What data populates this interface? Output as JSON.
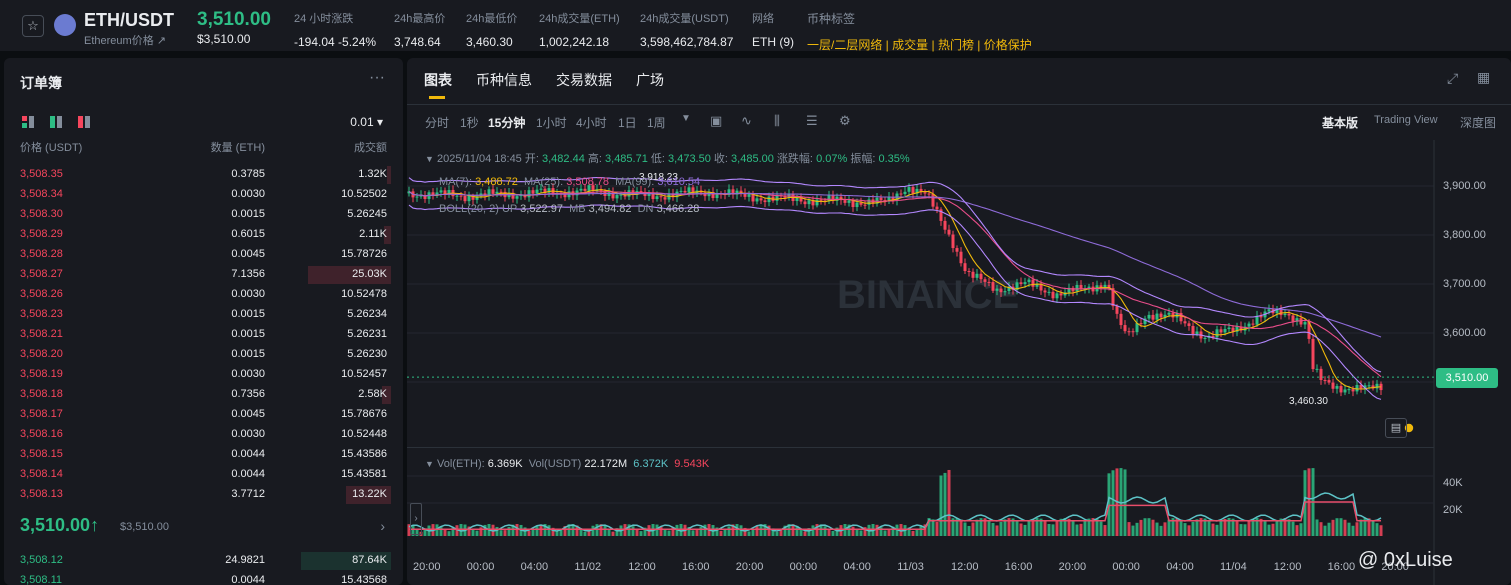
{
  "header": {
    "pair": "ETH/USDT",
    "subtitle": "Ethereum价格 ↗",
    "last_price": "3,510.00",
    "last_price_usd": "$3,510.00",
    "stats": [
      {
        "label": "24 小时涨跌",
        "value": "-194.04 -5.24%",
        "tone": "dn"
      },
      {
        "label": "24h最高价",
        "value": "3,748.64"
      },
      {
        "label": "24h最低价",
        "value": "3,460.30"
      },
      {
        "label": "24h成交量(ETH)",
        "value": "1,002,242.18"
      },
      {
        "label": "24h成交量(USDT)",
        "value": "3,598,462,784.87"
      },
      {
        "label": "网络",
        "value": "ETH (9)"
      }
    ],
    "tags_label": "币种标签",
    "tags": [
      "一层/二层网络",
      "成交量",
      "热门榜",
      "价格保护"
    ]
  },
  "orderbook": {
    "title": "订单簿",
    "precision": "0.01 ▾",
    "col_price": "价格 (USDT)",
    "col_amount": "数量 (ETH)",
    "col_total": "成交额",
    "asks": [
      {
        "price": "3,508.35",
        "amount": "0.3785",
        "total": "1.32K",
        "depth": 0.05
      },
      {
        "price": "3,508.34",
        "amount": "0.0030",
        "total": "10.52502",
        "depth": 0
      },
      {
        "price": "3,508.30",
        "amount": "0.0015",
        "total": "5.26245",
        "depth": 0
      },
      {
        "price": "3,508.29",
        "amount": "0.6015",
        "total": "2.11K",
        "depth": 0.08
      },
      {
        "price": "3,508.28",
        "amount": "0.0045",
        "total": "15.78726",
        "depth": 0
      },
      {
        "price": "3,508.27",
        "amount": "7.1356",
        "total": "25.03K",
        "depth": 0.92
      },
      {
        "price": "3,508.26",
        "amount": "0.0030",
        "total": "10.52478",
        "depth": 0
      },
      {
        "price": "3,508.23",
        "amount": "0.0015",
        "total": "5.26234",
        "depth": 0
      },
      {
        "price": "3,508.21",
        "amount": "0.0015",
        "total": "5.26231",
        "depth": 0
      },
      {
        "price": "3,508.20",
        "amount": "0.0015",
        "total": "5.26230",
        "depth": 0
      },
      {
        "price": "3,508.19",
        "amount": "0.0030",
        "total": "10.52457",
        "depth": 0
      },
      {
        "price": "3,508.18",
        "amount": "0.7356",
        "total": "2.58K",
        "depth": 0.1
      },
      {
        "price": "3,508.17",
        "amount": "0.0045",
        "total": "15.78676",
        "depth": 0
      },
      {
        "price": "3,508.16",
        "amount": "0.0030",
        "total": "10.52448",
        "depth": 0
      },
      {
        "price": "3,508.15",
        "amount": "0.0044",
        "total": "15.43586",
        "depth": 0
      },
      {
        "price": "3,508.14",
        "amount": "0.0044",
        "total": "15.43581",
        "depth": 0
      },
      {
        "price": "3,508.13",
        "amount": "3.7712",
        "total": "13.22K",
        "depth": 0.5
      }
    ],
    "mid_price": "3,510.00↑",
    "mid_usd": "$3,510.00",
    "bids": [
      {
        "price": "3,508.12",
        "amount": "24.9821",
        "total": "87.64K",
        "depth": 1
      },
      {
        "price": "3,508.11",
        "amount": "0.0044",
        "total": "15.43568",
        "depth": 0
      }
    ]
  },
  "chart": {
    "tabs": [
      "图表",
      "币种信息",
      "交易数据",
      "广场"
    ],
    "intervals": [
      "分时",
      "1秒",
      "15分钟",
      "1小时",
      "4小时",
      "1日",
      "1周"
    ],
    "active_interval": "15分钟",
    "views": [
      "基本版",
      "Trading View",
      "深度图"
    ],
    "ohlc": {
      "date": "2025/11/04 18:45",
      "open_label": "开:",
      "open": "3,482.44",
      "high_label": "高:",
      "high": "3,485.71",
      "low_label": "低:",
      "low": "3,473.50",
      "close_label": "收:",
      "close": "3,485.00",
      "chg_label": "涨跌幅:",
      "chg": "0.07%",
      "amp_label": "振幅:",
      "amp": "0.35%"
    },
    "ma": {
      "ma7_label": "MA(7):",
      "ma7": "3,488.72",
      "ma25_label": "MA(25):",
      "ma25": "3,508.78",
      "ma99_label": "MA(99):",
      "ma99": "3,610.54"
    },
    "boll": {
      "label": "BOLL(20, 2)",
      "up_label": "UP",
      "up": "3,522.97",
      "mb_label": "MB",
      "mb": "3,494.82",
      "dn_label": "DN",
      "dn": "3,466.28"
    },
    "price_labels": [
      "3,900.00",
      "3,800.00",
      "3,700.00",
      "3,600.00"
    ],
    "current_price_badge": "3,510.00",
    "high_marker": "3,918.23",
    "low_marker": "3,460.30",
    "vol": {
      "label": "Vol(ETH):",
      "eth": "6.369K",
      "usdt_label": "Vol(USDT)",
      "usdt": "22.172M",
      "ma1": "6.372K",
      "ma2": "9.543K"
    },
    "vol_labels": [
      "40K",
      "20K"
    ],
    "x_labels": [
      "20:00",
      "00:00",
      "04:00",
      "11/02",
      "12:00",
      "16:00",
      "20:00",
      "00:00",
      "04:00",
      "11/03",
      "12:00",
      "16:00",
      "20:00",
      "00:00",
      "04:00",
      "11/04",
      "12:00",
      "16:00",
      "20:00"
    ],
    "watermark": "BINANCE",
    "colors": {
      "up": "#2ebd85",
      "down": "#f6465d",
      "ma7": "#f0b90b",
      "ma25": "#e84d8a",
      "ma99": "#8e6bd8"
    }
  },
  "overlay": {
    "watermark": "@ 0xLuise"
  }
}
